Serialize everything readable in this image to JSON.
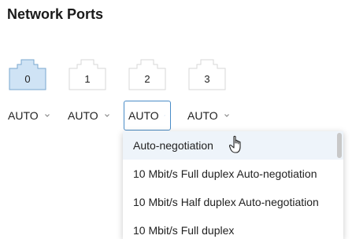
{
  "title": "Network Ports",
  "ports": [
    {
      "label": "0",
      "selected": true
    },
    {
      "label": "1",
      "selected": false
    },
    {
      "label": "2",
      "selected": false
    },
    {
      "label": "3",
      "selected": false
    }
  ],
  "speeds": [
    {
      "value": "AUTO",
      "open": false
    },
    {
      "value": "AUTO",
      "open": false
    },
    {
      "value": "AUTO",
      "open": true
    },
    {
      "value": "AUTO",
      "open": false
    }
  ],
  "dropdown": {
    "options": [
      "Auto-negotiation",
      "10 Mbit/s Full duplex Auto-negotiation",
      "10 Mbit/s Half duplex Auto-negotiation",
      "10 Mbit/s Full duplex"
    ],
    "hovered_index": 0
  },
  "colors": {
    "port_selected_fill": "#cfe3f5",
    "port_selected_stroke": "#7aa7cf",
    "port_stroke": "#d7d7d7",
    "accent": "#4a8cc7"
  }
}
